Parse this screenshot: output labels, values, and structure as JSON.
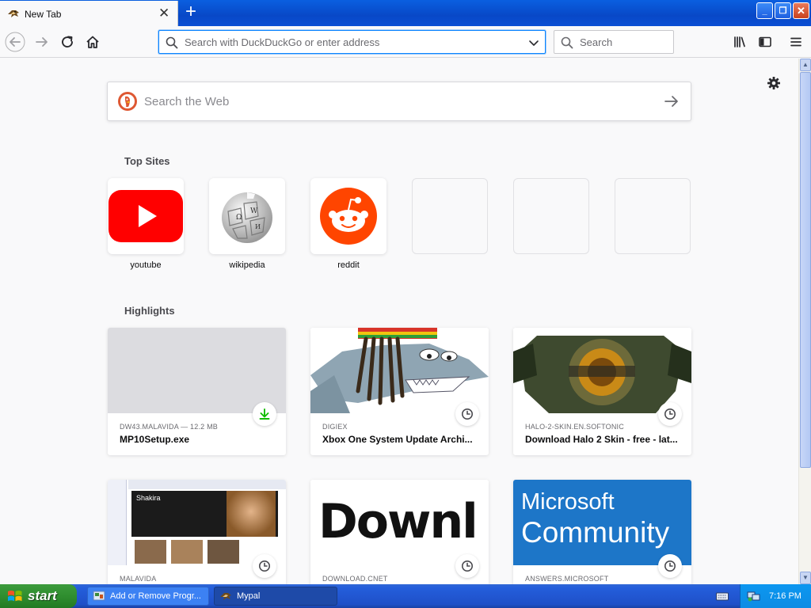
{
  "browser": {
    "tab": {
      "title": "New Tab"
    },
    "url_placeholder": "Search with DuckDuckGo or enter address",
    "search_placeholder": "Search"
  },
  "newtab": {
    "web_search_placeholder": "Search the Web",
    "top_sites_heading": "Top Sites",
    "top_sites": [
      {
        "label": "youtube",
        "icon": "youtube-logo"
      },
      {
        "label": "wikipedia",
        "icon": "wikipedia-logo"
      },
      {
        "label": "reddit",
        "icon": "reddit-logo"
      }
    ],
    "highlights_heading": "Highlights",
    "highlights": [
      {
        "source": "DW43.MALAVIDA — 12.2 MB",
        "title": "MP10Setup.exe",
        "badge": "download-icon"
      },
      {
        "source": "DIGIEX",
        "title": "Xbox One System Update Archi...",
        "badge": "clock-icon"
      },
      {
        "source": "HALO-2-SKIN.EN.SOFTONIC",
        "title": "Download Halo 2 Skin - free - lat...",
        "badge": "clock-icon"
      },
      {
        "source": "MALAVIDA",
        "title": "",
        "badge": "clock-icon",
        "thumb_text": "Shakira"
      },
      {
        "source": "DOWNLOAD.CNET",
        "title": "",
        "badge": "clock-icon",
        "thumb_text": "Downl"
      },
      {
        "source": "ANSWERS.MICROSOFT",
        "title": "",
        "badge": "clock-icon",
        "thumb_line1": "Microsoft",
        "thumb_line2": "Community"
      }
    ]
  },
  "taskbar": {
    "start_label": "start",
    "tasks": [
      {
        "label": "Add or Remove Progr...",
        "icon": "control-panel-icon"
      },
      {
        "label": "Mypal",
        "icon": "mypal-icon"
      }
    ],
    "clock": "7:16 PM"
  },
  "colors": {
    "accent": "#0a84ff",
    "xp_blue": "#0a4fd4",
    "start_green": "#2f8e2f",
    "reddit": "#ff4500",
    "youtube": "#ff0000"
  }
}
